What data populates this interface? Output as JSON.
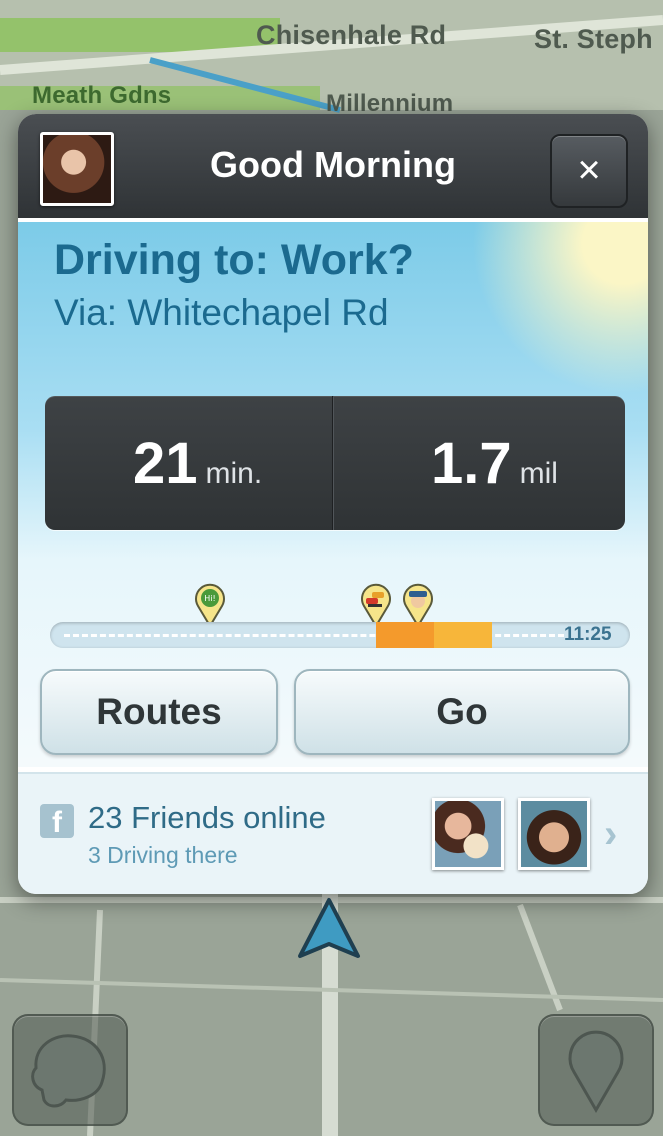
{
  "map": {
    "streets": [
      "Chisenhale Rd",
      "St. Steph",
      "Meath Gdns",
      "Millennium"
    ]
  },
  "card": {
    "header_title": "Good Morning",
    "close_label": "×",
    "destination": "Driving to: Work?",
    "via": "Via: Whitechapel Rd",
    "duration": {
      "value": "21",
      "unit": "min."
    },
    "distance": {
      "value": "1.7",
      "unit": "mil"
    },
    "eta": "11:25",
    "routes_label": "Routes",
    "go_label": "Go",
    "friends_online": "23 Friends online",
    "driving_there": "3 Driving there",
    "facebook_glyph": "f",
    "chevron": "›"
  },
  "icons": [
    "avatar",
    "close-icon",
    "chat-hi-pin-icon",
    "traffic-pin-icon",
    "police-pin-icon",
    "facebook-icon",
    "chevron-right-icon",
    "navigation-arrow-icon",
    "waze-menu-icon",
    "report-pin-icon"
  ],
  "colors": {
    "title_blue": "#1b6a8f",
    "jam_orange": "#f49a2c",
    "jam_yellow": "#f7b63a",
    "header_dark": "#3a3e41"
  }
}
